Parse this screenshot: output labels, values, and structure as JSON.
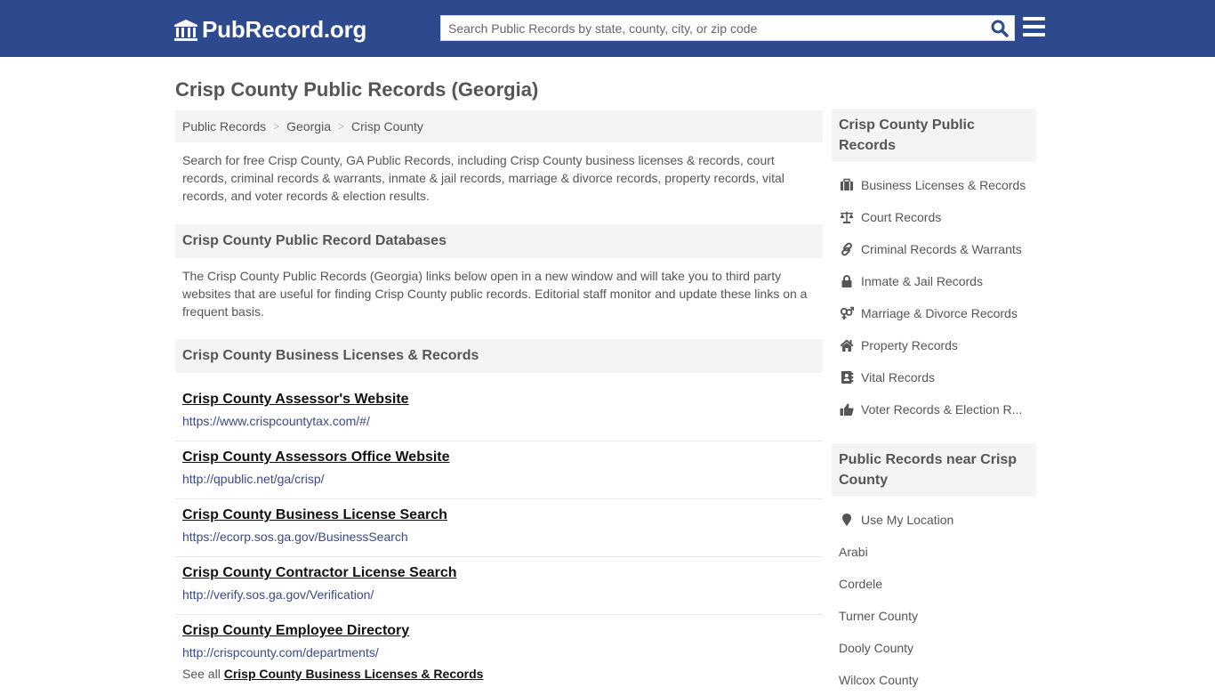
{
  "header": {
    "logo_text": "PubRecord.org",
    "search_placeholder": "Search Public Records by state, county, city, or zip code",
    "brand_color": "#2e4a8e"
  },
  "page": {
    "title": "Crisp County Public Records (Georgia)"
  },
  "breadcrumb": [
    {
      "label": "Public Records"
    },
    {
      "label": "Georgia"
    },
    {
      "label": "Crisp County"
    }
  ],
  "breadcrumb_separator": ">",
  "intro": "Search for free Crisp County, GA Public Records, including Crisp County business licenses & records, court records, criminal records & warrants, inmate & jail records, marriage & divorce records, property records, vital records, and voter records & election results.",
  "databases": {
    "heading": "Crisp County Public Record Databases",
    "description": "The Crisp County Public Records (Georgia) links below open in a new window and will take you to third party websites that are useful for finding Crisp County public records. Editorial staff monitor and update these links on a frequent basis."
  },
  "business_section": {
    "heading": "Crisp County Business Licenses & Records",
    "links": [
      {
        "title": "Crisp County Assessor's Website",
        "url": "https://www.crispcountytax.com/#/"
      },
      {
        "title": "Crisp County Assessors Office Website",
        "url": "http://qpublic.net/ga/crisp/"
      },
      {
        "title": "Crisp County Business License Search",
        "url": "https://ecorp.sos.ga.gov/BusinessSearch"
      },
      {
        "title": "Crisp County Contractor License Search",
        "url": "http://verify.sos.ga.gov/Verification/"
      },
      {
        "title": "Crisp County Employee Directory",
        "url": "http://crispcounty.com/departments/"
      }
    ],
    "see_all_prefix": "See all",
    "see_all_link": "Crisp County Business Licenses & Records"
  },
  "sidebar": {
    "records_heading": "Crisp County Public Records",
    "records": [
      {
        "label": "Business Licenses & Records",
        "icon": "briefcase-icon"
      },
      {
        "label": "Court Records",
        "icon": "balance-scale-icon"
      },
      {
        "label": "Criminal Records & Warrants",
        "icon": "link-icon"
      },
      {
        "label": "Inmate & Jail Records",
        "icon": "lock-icon"
      },
      {
        "label": "Marriage & Divorce Records",
        "icon": "venus-mars-icon"
      },
      {
        "label": "Property Records",
        "icon": "home-icon"
      },
      {
        "label": "Vital Records",
        "icon": "address-book-icon"
      },
      {
        "label": "Voter Records & Election R...",
        "icon": "thumbs-up-icon"
      }
    ],
    "nearby_heading": "Public Records near Crisp County",
    "use_location": "Use My Location",
    "nearby": [
      "Arabi",
      "Cordele",
      "Turner County",
      "Dooly County",
      "Wilcox County"
    ]
  }
}
